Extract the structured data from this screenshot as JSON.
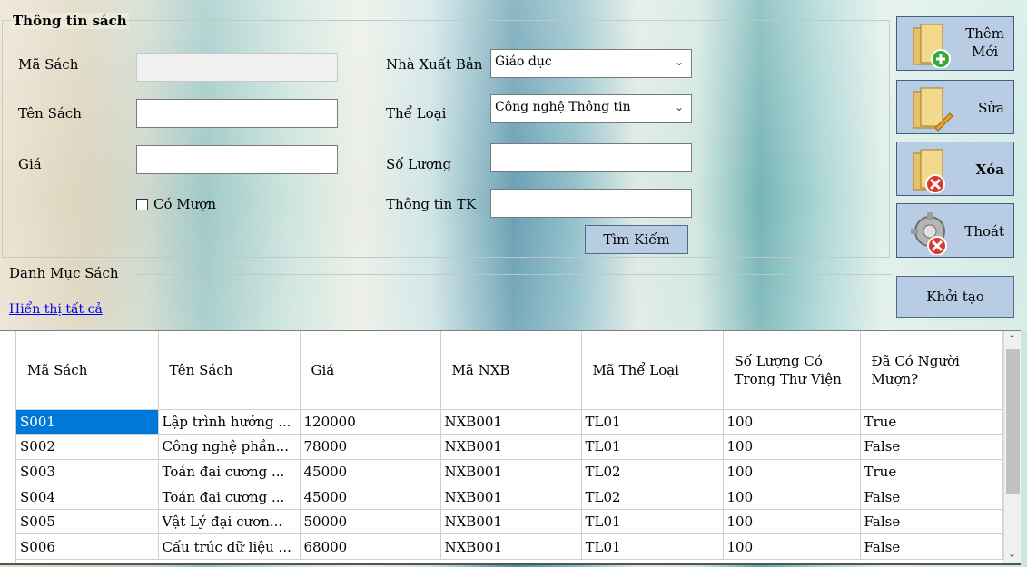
{
  "group": {
    "title": "Thông tin sách"
  },
  "form": {
    "ma_sach_label": "Mã Sách",
    "ma_sach_value": "",
    "ten_sach_label": "Tên Sách",
    "ten_sach_value": "",
    "gia_label": "Giá",
    "gia_value": "",
    "co_muon_label": "Có Mượn",
    "nxb_label": "Nhà Xuất Bản",
    "nxb_value": "Giáo dục",
    "the_loai_label": "Thể Loại",
    "the_loai_value": "Công nghệ Thông tin",
    "so_luong_label": "Số Lượng",
    "so_luong_value": "",
    "thong_tin_tk_label": "Thông tin TK",
    "thong_tin_tk_value": "",
    "search_button": "Tìm Kiếm"
  },
  "buttons": {
    "them_moi_line1": "Thêm",
    "them_moi_line2": "Mới",
    "sua": "Sửa",
    "xoa": "Xóa",
    "thoat": "Thoát",
    "khoi_tao": "Khởi tạo"
  },
  "catalog": {
    "title": "Danh Mục Sách",
    "show_all": "Hiển thị tất cả"
  },
  "grid": {
    "headers": [
      "Mã Sách",
      "Tên Sách",
      "Giá",
      "Mã NXB",
      "Mã Thể Loại",
      "Số Lượng Có Trong Thư Viện",
      "Đã Có Người Mượn?"
    ],
    "rows": [
      [
        "S001",
        "Lập trình hướng ...",
        "120000",
        "NXB001",
        "TL01",
        "100",
        "True"
      ],
      [
        "S002",
        "Công nghệ phần...",
        "78000",
        "NXB001",
        "TL01",
        "100",
        "False"
      ],
      [
        "S003",
        "Toán đại cương ...",
        "45000",
        "NXB001",
        "TL02",
        "100",
        "True"
      ],
      [
        "S004",
        "Toán đại cương ...",
        "45000",
        "NXB001",
        "TL02",
        "100",
        "False"
      ],
      [
        "S005",
        "Vật Lý đại cươn...",
        "50000",
        "NXB001",
        "TL01",
        "100",
        "False"
      ],
      [
        "S006",
        "Cấu trúc dữ liệu ...",
        "68000",
        "NXB001",
        "TL01",
        "100",
        "False"
      ]
    ]
  },
  "icons": {
    "them_moi": "folder-add-icon",
    "sua": "folder-edit-icon",
    "xoa": "folder-delete-icon",
    "thoat": "gear-exit-icon"
  },
  "colors": {
    "button_bg": "#b8cde3",
    "selection": "#0078d7",
    "link": "#0000ee"
  }
}
